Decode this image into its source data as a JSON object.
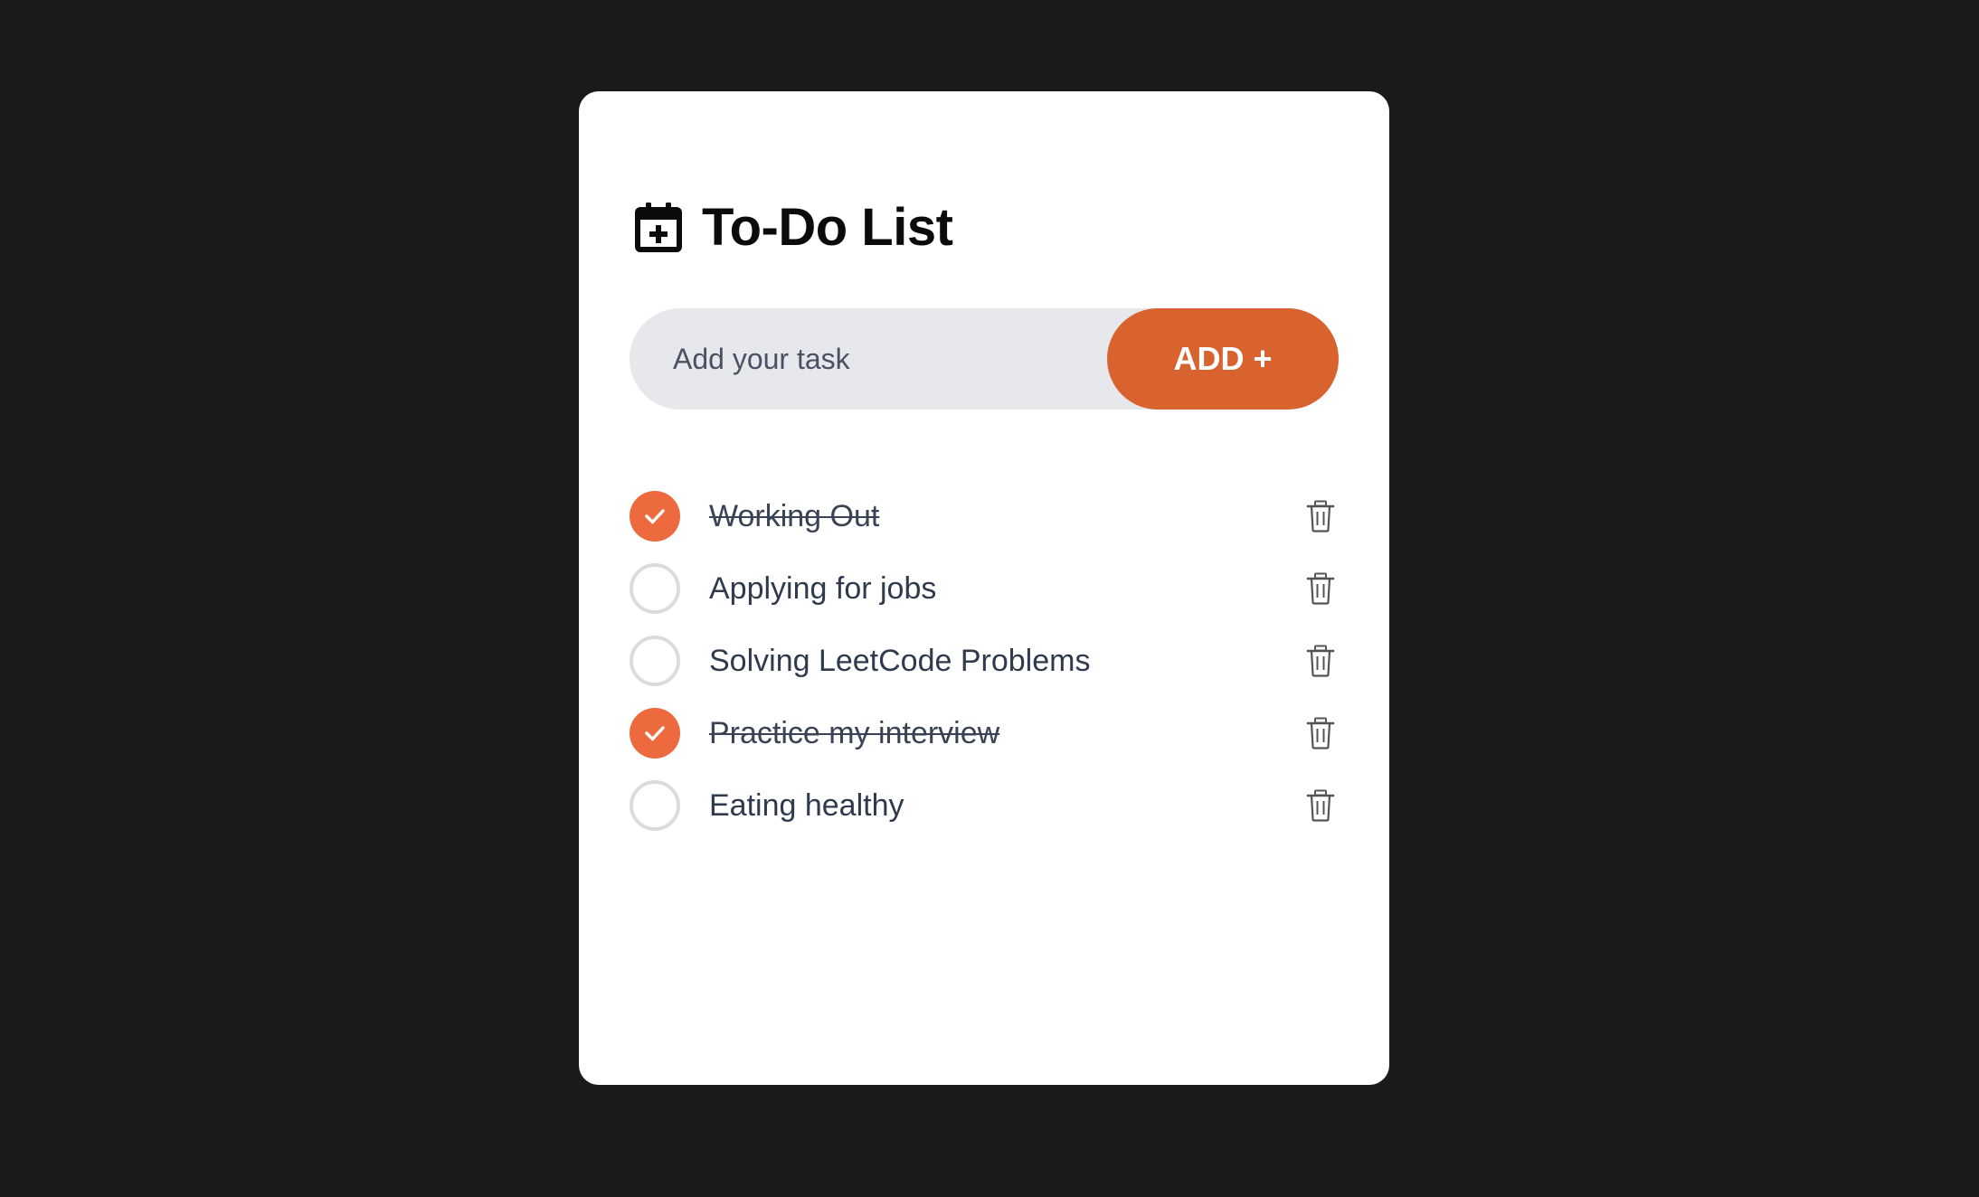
{
  "app": {
    "title": "To-Do List"
  },
  "input": {
    "placeholder": "Add your task",
    "value": ""
  },
  "add_button": {
    "label": "ADD +"
  },
  "tasks": [
    {
      "text": "Working Out",
      "done": true
    },
    {
      "text": "Applying for jobs",
      "done": false
    },
    {
      "text": "Solving LeetCode Problems",
      "done": false
    },
    {
      "text": "Practice my interview",
      "done": true
    },
    {
      "text": "Eating healthy",
      "done": false
    }
  ],
  "colors": {
    "background": "#1b1a19",
    "card": "#ffffff",
    "accent": "#d9632e",
    "checked": "#ec6a3e",
    "input_bg": "#e6e8ec",
    "text": "#2f3a4e"
  },
  "icons": {
    "header": "calendar-plus-icon",
    "check": "checkmark-icon",
    "delete": "trash-icon"
  }
}
